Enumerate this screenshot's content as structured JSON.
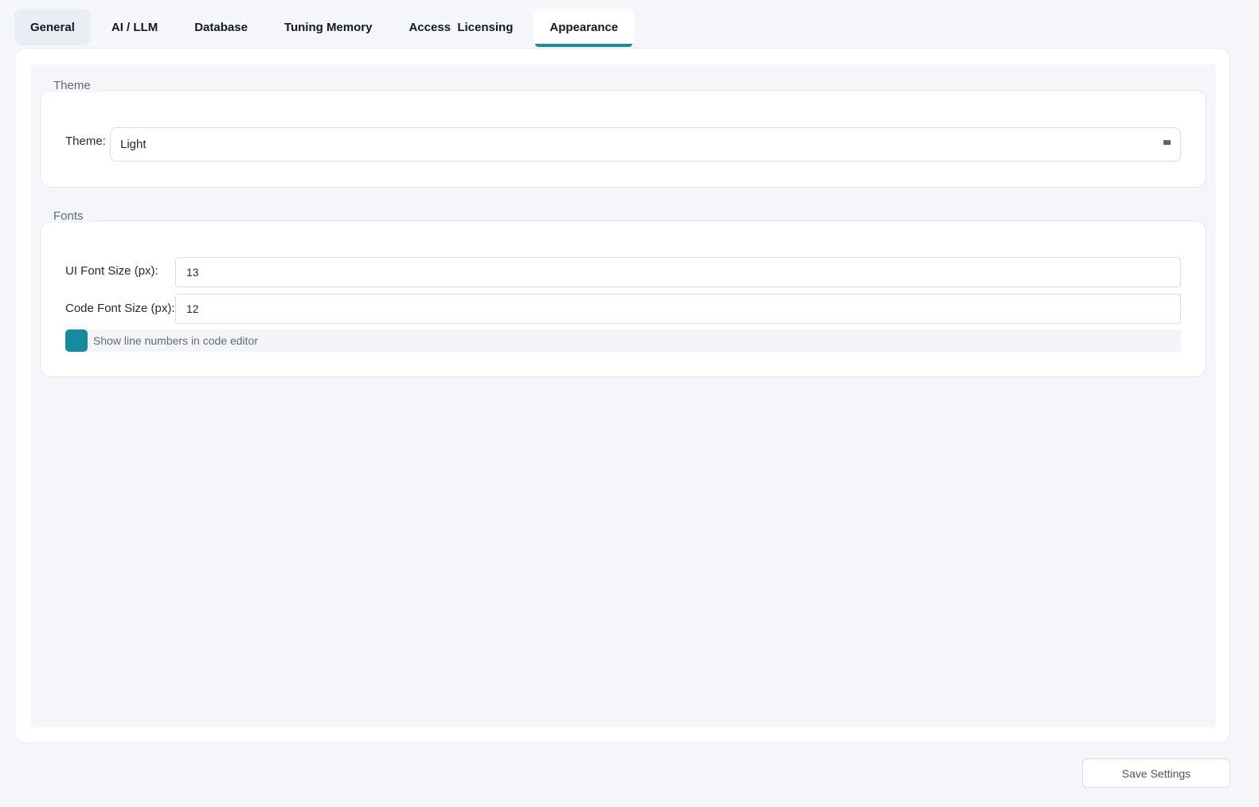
{
  "tabs": [
    {
      "label": "General"
    },
    {
      "label": "AI / LLM"
    },
    {
      "label": "Database"
    },
    {
      "label": "Tuning Memory"
    },
    {
      "label": "Access  Licensing"
    },
    {
      "label": "Appearance"
    }
  ],
  "active_tab": "Appearance",
  "theme_group": {
    "legend": "Theme",
    "label": "Theme:",
    "value": "Light"
  },
  "fonts_group": {
    "legend": "Fonts",
    "ui_font_label": "UI Font Size (px):",
    "ui_font_value": "13",
    "code_font_label": "Code Font Size (px):",
    "code_font_value": "12",
    "line_numbers_label": "Show line numbers in code editor",
    "line_numbers_checked": true
  },
  "save_label": "Save Settings",
  "colors": {
    "accent": "#1b8a9a",
    "checkbox": "#158b9d",
    "background": "#f5f7fa"
  }
}
